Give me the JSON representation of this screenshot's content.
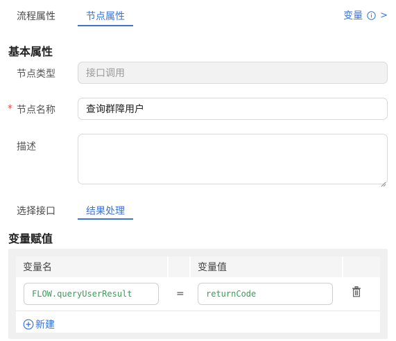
{
  "tabs": [
    {
      "label": "流程属性",
      "active": false
    },
    {
      "label": "节点属性",
      "active": true
    }
  ],
  "variables_link": {
    "label": "变量",
    "info_icon": "info-circle-icon",
    "chevron": ">"
  },
  "basic_section": {
    "title": "基本属性"
  },
  "fields": {
    "node_type": {
      "label": "节点类型",
      "value": "接口调用",
      "disabled": true
    },
    "node_name": {
      "label": "节点名称",
      "required_mark": "*",
      "value": "查询群障用户"
    },
    "description": {
      "label": "描述",
      "value": ""
    }
  },
  "subtabs": [
    {
      "label": "选择接口",
      "active": false
    },
    {
      "label": "结果处理",
      "active": true
    }
  ],
  "assign_section": {
    "title": "变量赋值",
    "headers": {
      "name": "变量名",
      "value": "变量值"
    },
    "rows": [
      {
        "name": "FLOW.queryUserResult",
        "operator": "=",
        "value": "returnCode",
        "delete_icon": "trash-icon"
      }
    ],
    "add_label": "新建",
    "add_icon": "plus-circle-icon"
  },
  "colors": {
    "accent": "#3a73d9",
    "required": "#e34d4d",
    "code": "#3f9a58"
  }
}
